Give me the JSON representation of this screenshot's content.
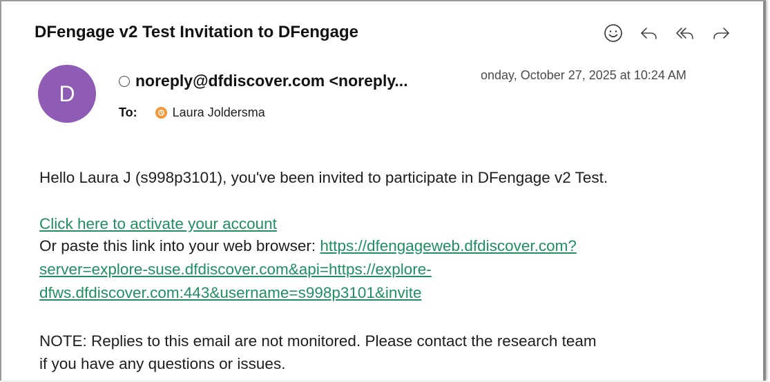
{
  "header": {
    "subject": "DFengage v2 Test Invitation to DFengage",
    "toolbar": [
      {
        "name": "emoji-reaction-icon"
      },
      {
        "name": "reply-icon"
      },
      {
        "name": "reply-all-icon"
      },
      {
        "name": "forward-icon"
      }
    ]
  },
  "sender": {
    "avatar_initial": "D",
    "avatar_color": "#8e5bb5",
    "from": "noreply@dfdiscover.com <noreply...",
    "date": "onday, October 27, 2025 at 10:24 AM"
  },
  "recipients": {
    "to_label": "To:",
    "name": "Laura Joldersma",
    "dot_color": "#f0983a"
  },
  "body": {
    "greeting": "Hello Laura J (s998p3101), you've been invited to participate in DFengage v2 Test.",
    "activate_link": "Click here to activate your account",
    "paste_prefix": "Or paste this link into your web browser: ",
    "url_line1": "https://dfengageweb.dfdiscover.com?",
    "url_line2": "server=explore-suse.dfdiscover.com&api=https://explore-",
    "url_line3": "dfws.dfdiscover.com:443&username=s998p3101&invite",
    "note_line1": "NOTE: Replies to this email are not monitored. Please contact the research team",
    "note_line2": "if you have any questions or issues."
  },
  "colors": {
    "link": "#1f8f5f"
  }
}
